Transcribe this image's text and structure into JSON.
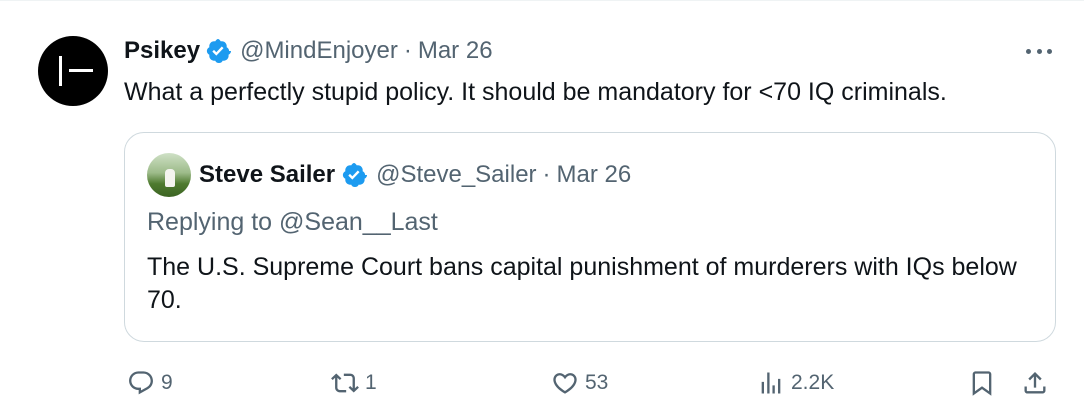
{
  "tweet": {
    "author": {
      "name": "Psikey",
      "handle": "@MindEnjoyer",
      "separator": "·",
      "date": "Mar 26",
      "verified": true
    },
    "text": "What a perfectly stupid policy. It should be mandatory for <70 IQ criminals.",
    "more_icon": "more-horizontal-icon"
  },
  "quoted": {
    "author": {
      "name": "Steve Sailer",
      "handle": "@Steve_Sailer",
      "separator": "·",
      "date": "Mar 26",
      "verified": true
    },
    "replying_prefix": "Replying to ",
    "replying_to": "@Sean__Last",
    "text": "The U.S. Supreme Court bans capital punishment of murderers with IQs below 70."
  },
  "actions": {
    "reply": {
      "icon": "reply-icon",
      "count": "9"
    },
    "retweet": {
      "icon": "retweet-icon",
      "count": "1"
    },
    "like": {
      "icon": "heart-icon",
      "count": "53"
    },
    "views": {
      "icon": "views-icon",
      "count": "2.2K"
    },
    "bookmark": {
      "icon": "bookmark-icon"
    },
    "share": {
      "icon": "share-icon"
    }
  },
  "colors": {
    "text_primary": "#0f1419",
    "text_secondary": "#536471",
    "verified_blue": "#1d9bf0",
    "border": "#cfd9de"
  }
}
